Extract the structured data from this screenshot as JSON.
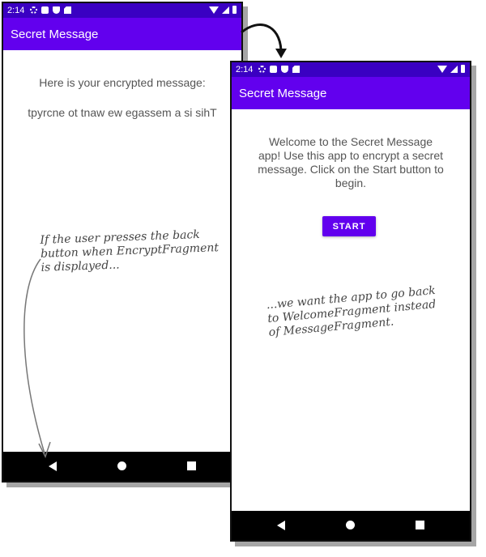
{
  "left_phone": {
    "status": {
      "time": "2:14"
    },
    "app_title": "Secret Message",
    "heading": "Here is your encrypted message:",
    "message": "tpyrcne ot tnaw ew egassem a si sihT"
  },
  "right_phone": {
    "status": {
      "time": "2:14"
    },
    "app_title": "Secret Message",
    "welcome_lines": [
      "Welcome to the Secret Message",
      "app! Use this app to encrypt a secret",
      "message. Click on the Start button to",
      "begin."
    ],
    "start_label": "START"
  },
  "annotations": {
    "left_note": [
      "If the user presses the back",
      "button when EncryptFragment",
      "is displayed..."
    ],
    "right_note": [
      "...we want the app to go back",
      "to WelcomeFragment instead",
      "of MessageFragment."
    ]
  },
  "colors": {
    "app_bar": "#6200ee",
    "status_bar": "#3a00c2",
    "text": "#555555",
    "nav_bar": "#000000"
  },
  "icons": [
    "gear-icon",
    "a-icon",
    "shield-icon",
    "sd-card-icon",
    "wifi-icon",
    "signal-icon",
    "battery-icon",
    "back-icon",
    "home-icon",
    "recents-icon"
  ]
}
